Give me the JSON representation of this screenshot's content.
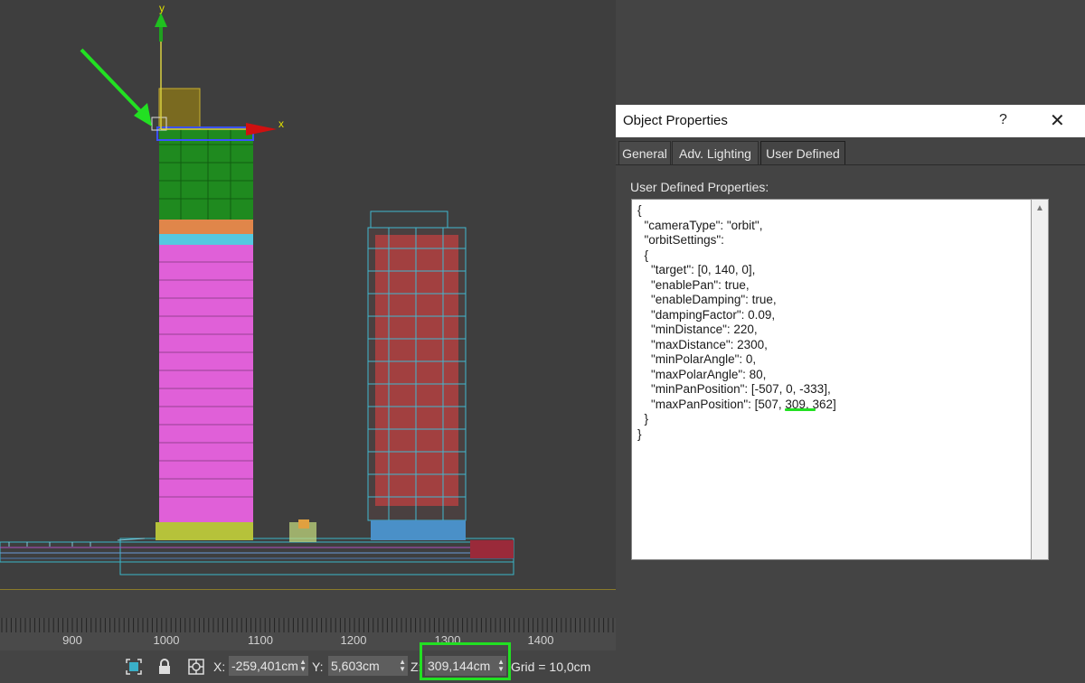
{
  "viewport": {
    "axes": {
      "x_label": "x",
      "y_label": "y"
    }
  },
  "ruler": {
    "ticks": [
      "900",
      "1000",
      "1100",
      "1200",
      "1300",
      "1400"
    ]
  },
  "statusbar": {
    "x_label": "X:",
    "x_value": "-259,401cm",
    "y_label": "Y:",
    "y_value": "5,603cm",
    "z_label": "Z:",
    "z_value": "309,144cm",
    "grid_text": "Grid = 10,0cm"
  },
  "dialog": {
    "title": "Object Properties",
    "help": "?",
    "close": "✕",
    "tabs": [
      "General",
      "Adv. Lighting",
      "User Defined"
    ],
    "active_tab": "User Defined",
    "section_label": "User Defined Properties:",
    "lines": [
      "{",
      "  \"cameraType\": \"orbit\",",
      "  \"orbitSettings\":",
      "  {",
      "    \"target\": [0, 140, 0],",
      "    \"enablePan\": true,",
      "    \"enableDamping\": true,",
      "    \"dampingFactor\": 0.09,",
      "    \"minDistance\": 220,",
      "    \"maxDistance\": 2300,",
      "    \"minPolarAngle\": 0,",
      "    \"maxPolarAngle\": 80,",
      "    \"minPanPosition\": [-507, 0, -333],",
      "    \"maxPanPosition\": [507, 309, 362]",
      "  }",
      "}"
    ]
  },
  "colors": {
    "highlight": "#22e022",
    "tower_green": "#1f8a1f",
    "tower_orange": "#e0864a",
    "tower_cyan": "#55c8e0",
    "tower_magenta": "#e060d8",
    "tower_base": "#b6c23a"
  }
}
